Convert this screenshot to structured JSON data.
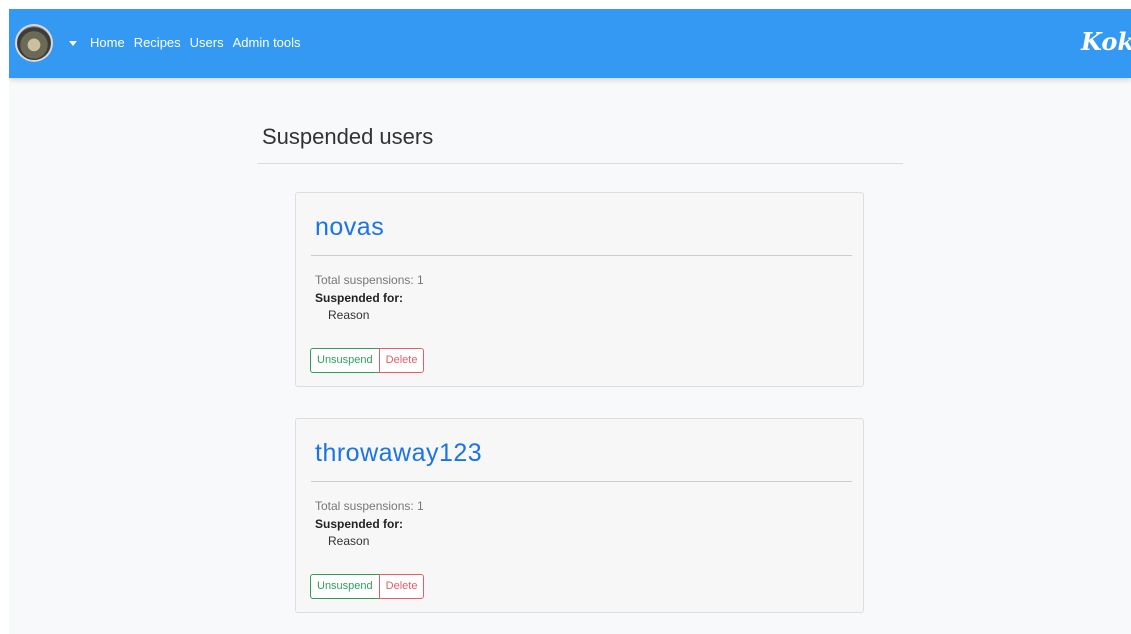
{
  "navbar": {
    "links": [
      "Home",
      "Recipes",
      "Users",
      "Admin tools"
    ],
    "brand": "Koki",
    "accent_color": "#3399f3"
  },
  "page": {
    "title": "Suspended users"
  },
  "users": [
    {
      "name": "novas",
      "total_suspensions": "Total suspensions: 1",
      "suspended_for_label": "Suspended for:",
      "reason": "Reason",
      "unsuspend_label": "Unsuspend",
      "delete_label": "Delete"
    },
    {
      "name": "throwaway123",
      "total_suspensions": "Total suspensions: 1",
      "suspended_for_label": "Suspended for:",
      "reason": "Reason",
      "unsuspend_label": "Unsuspend",
      "delete_label": "Delete"
    }
  ],
  "icons": {
    "avatar": "user-avatar",
    "caret": "caret-down-icon"
  }
}
